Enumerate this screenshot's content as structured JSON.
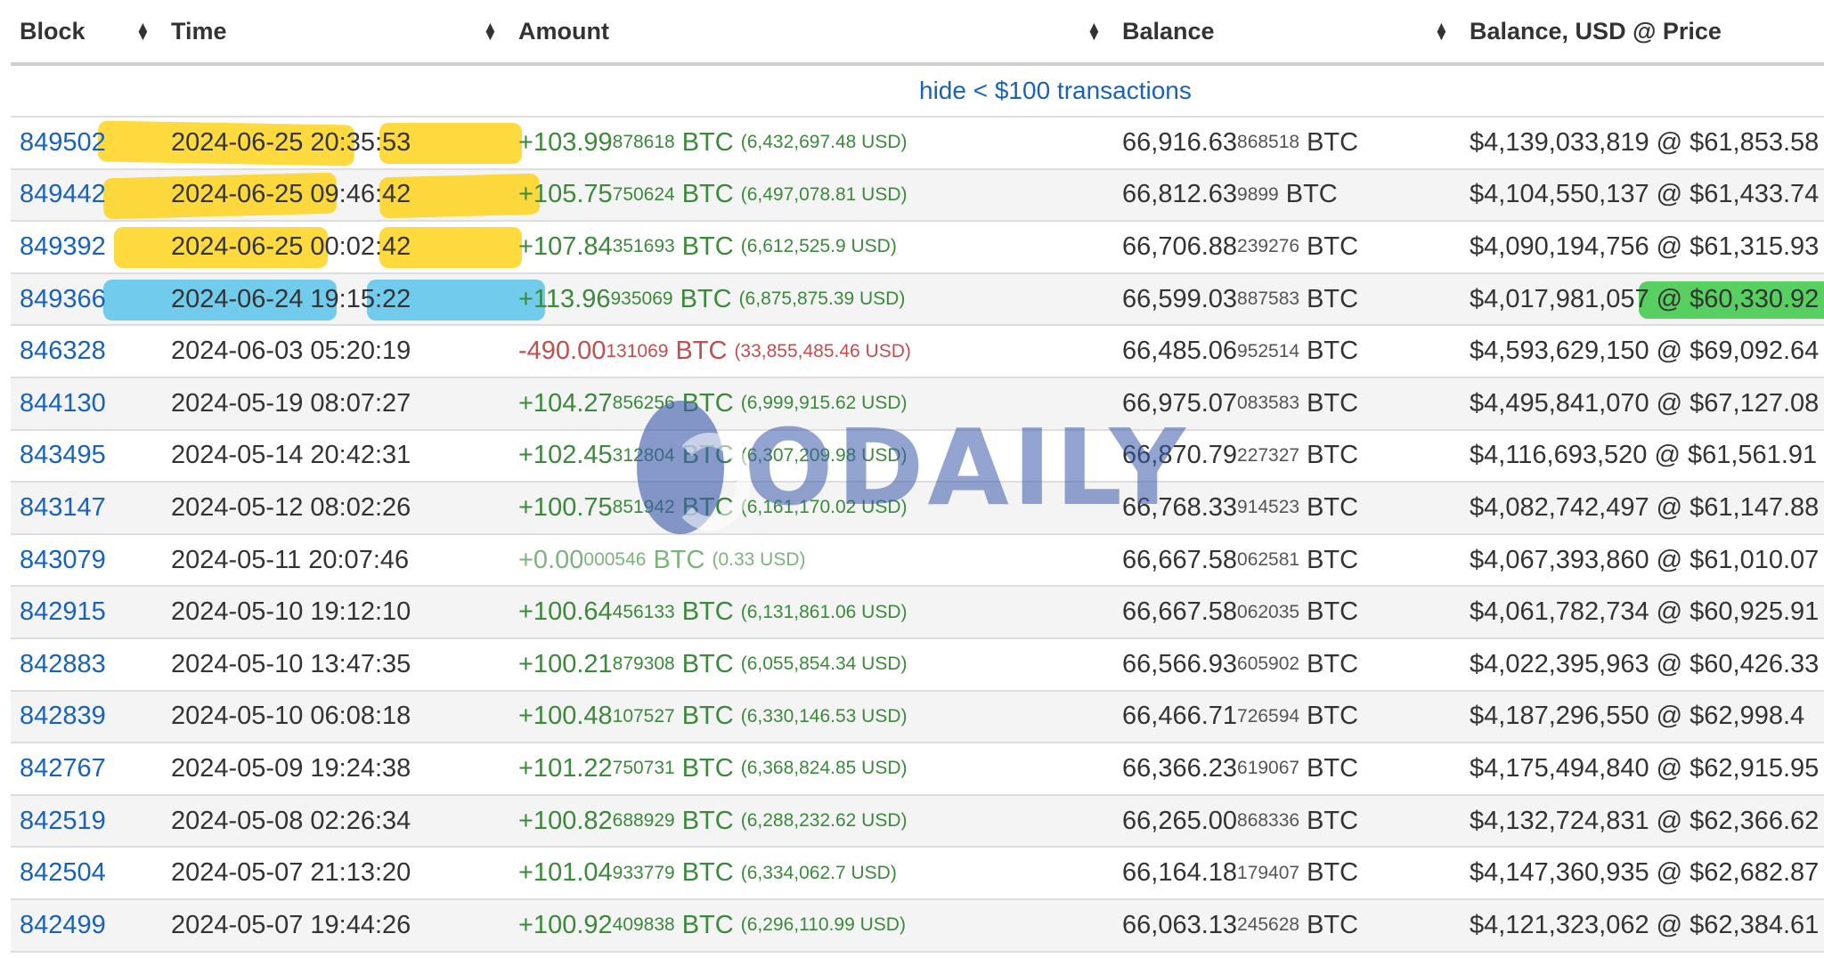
{
  "headers": {
    "block": "Block",
    "time": "Time",
    "amount": "Amount",
    "balance": "Balance",
    "balance_usd": "Balance, USD @ Price"
  },
  "hide_link": "hide < $100 transactions",
  "watermark": "ODAILY",
  "rows": [
    {
      "block": "849502",
      "time": "2024-06-25 20:35:53",
      "amt_main": "+103.99",
      "amt_small": "878618",
      "amt_unit": "BTC",
      "amt_usd": "(6,432,697.48 USD)",
      "bal_main": "66,916.63",
      "bal_small": "868518",
      "bal_unit": "BTC",
      "bal_usd": "$4,139,033,819 @ $61,853.58"
    },
    {
      "block": "849442",
      "time": "2024-06-25 09:46:42",
      "amt_main": "+105.75",
      "amt_small": "750624",
      "amt_unit": "BTC",
      "amt_usd": "(6,497,078.81 USD)",
      "bal_main": "66,812.63",
      "bal_small": "9899",
      "bal_unit": "BTC",
      "bal_usd": "$4,104,550,137 @ $61,433.74"
    },
    {
      "block": "849392",
      "time": "2024-06-25 00:02:42",
      "amt_main": "+107.84",
      "amt_small": "351693",
      "amt_unit": "BTC",
      "amt_usd": "(6,612,525.9 USD)",
      "bal_main": "66,706.88",
      "bal_small": "239276",
      "bal_unit": "BTC",
      "bal_usd": "$4,090,194,756 @ $61,315.93"
    },
    {
      "block": "849366",
      "time": "2024-06-24 19:15:22",
      "amt_main": "+113.96",
      "amt_small": "935069",
      "amt_unit": "BTC",
      "amt_usd": "(6,875,875.39 USD)",
      "bal_main": "66,599.03",
      "bal_small": "887583",
      "bal_unit": "BTC",
      "bal_usd": "$4,017,981,057 @ $60,330.92"
    },
    {
      "block": "846328",
      "time": "2024-06-03 05:20:19",
      "amt_main": "-490.00",
      "amt_small": "131069",
      "amt_unit": "BTC",
      "amt_usd": "(33,855,485.46 USD)",
      "bal_main": "66,485.06",
      "bal_small": "952514",
      "bal_unit": "BTC",
      "bal_usd": "$4,593,629,150 @ $69,092.64"
    },
    {
      "block": "844130",
      "time": "2024-05-19 08:07:27",
      "amt_main": "+104.27",
      "amt_small": "856256",
      "amt_unit": "BTC",
      "amt_usd": "(6,999,915.62 USD)",
      "bal_main": "66,975.07",
      "bal_small": "083583",
      "bal_unit": "BTC",
      "bal_usd": "$4,495,841,070 @ $67,127.08"
    },
    {
      "block": "843495",
      "time": "2024-05-14 20:42:31",
      "amt_main": "+102.45",
      "amt_small": "312804",
      "amt_unit": "BTC",
      "amt_usd": "(6,307,209.98 USD)",
      "bal_main": "66,870.79",
      "bal_small": "227327",
      "bal_unit": "BTC",
      "bal_usd": "$4,116,693,520 @ $61,561.91"
    },
    {
      "block": "843147",
      "time": "2024-05-12 08:02:26",
      "amt_main": "+100.75",
      "amt_small": "851942",
      "amt_unit": "BTC",
      "amt_usd": "(6,161,170.02 USD)",
      "bal_main": "66,768.33",
      "bal_small": "914523",
      "bal_unit": "BTC",
      "bal_usd": "$4,082,742,497 @ $61,147.88"
    },
    {
      "block": "843079",
      "time": "2024-05-11 20:07:46",
      "amt_main": "+0.00",
      "amt_small": "000546",
      "amt_unit": "BTC",
      "amt_usd": "(0.33 USD)",
      "bal_main": "66,667.58",
      "bal_small": "062581",
      "bal_unit": "BTC",
      "bal_usd": "$4,067,393,860 @ $61,010.07"
    },
    {
      "block": "842915",
      "time": "2024-05-10 19:12:10",
      "amt_main": "+100.64",
      "amt_small": "456133",
      "amt_unit": "BTC",
      "amt_usd": "(6,131,861.06 USD)",
      "bal_main": "66,667.58",
      "bal_small": "062035",
      "bal_unit": "BTC",
      "bal_usd": "$4,061,782,734 @ $60,925.91"
    },
    {
      "block": "842883",
      "time": "2024-05-10 13:47:35",
      "amt_main": "+100.21",
      "amt_small": "879308",
      "amt_unit": "BTC",
      "amt_usd": "(6,055,854.34 USD)",
      "bal_main": "66,566.93",
      "bal_small": "605902",
      "bal_unit": "BTC",
      "bal_usd": "$4,022,395,963 @ $60,426.33"
    },
    {
      "block": "842839",
      "time": "2024-05-10 06:08:18",
      "amt_main": "+100.48",
      "amt_small": "107527",
      "amt_unit": "BTC",
      "amt_usd": "(6,330,146.53 USD)",
      "bal_main": "66,466.71",
      "bal_small": "726594",
      "bal_unit": "BTC",
      "bal_usd": "$4,187,296,550 @ $62,998.4"
    },
    {
      "block": "842767",
      "time": "2024-05-09 19:24:38",
      "amt_main": "+101.22",
      "amt_small": "750731",
      "amt_unit": "BTC",
      "amt_usd": "(6,368,824.85 USD)",
      "bal_main": "66,366.23",
      "bal_small": "619067",
      "bal_unit": "BTC",
      "bal_usd": "$4,175,494,840 @ $62,915.95"
    },
    {
      "block": "842519",
      "time": "2024-05-08 02:26:34",
      "amt_main": "+100.82",
      "amt_small": "688929",
      "amt_unit": "BTC",
      "amt_usd": "(6,288,232.62 USD)",
      "bal_main": "66,265.00",
      "bal_small": "868336",
      "bal_unit": "BTC",
      "bal_usd": "$4,132,724,831 @ $62,366.62"
    },
    {
      "block": "842504",
      "time": "2024-05-07 21:13:20",
      "amt_main": "+101.04",
      "amt_small": "933779",
      "amt_unit": "BTC",
      "amt_usd": "(6,334,062.7 USD)",
      "bal_main": "66,164.18",
      "bal_small": "179407",
      "bal_unit": "BTC",
      "bal_usd": "$4,147,360,935 @ $62,682.87"
    },
    {
      "block": "842499",
      "time": "2024-05-07 19:44:26",
      "amt_main": "+100.92",
      "amt_small": "409838",
      "amt_unit": "BTC",
      "amt_usd": "(6,296,110.99 USD)",
      "bal_main": "66,063.13",
      "bal_small": "245628",
      "bal_unit": "BTC",
      "bal_usd": "$4,121,323,062 @ $62,384.61"
    }
  ]
}
